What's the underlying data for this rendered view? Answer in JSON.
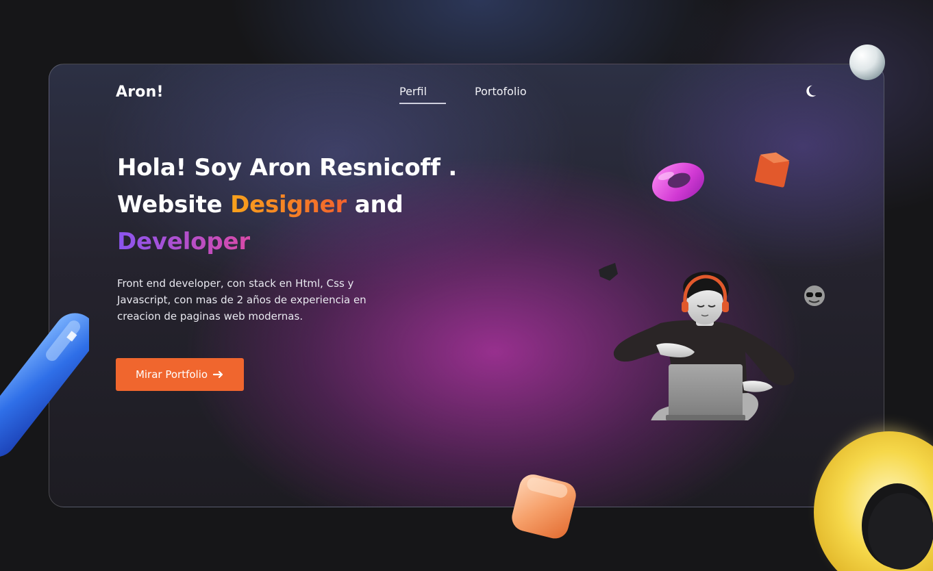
{
  "nav": {
    "logo": "Aron!",
    "links": [
      {
        "label": "Perfil",
        "active": true
      },
      {
        "label": "Portofolio",
        "active": false
      }
    ],
    "theme_icon": "moon-icon"
  },
  "hero": {
    "line1": "Hola! Soy Aron Resnicoff .",
    "line2_a": "Website ",
    "line2_highlight": "Designer",
    "line2_b": " and",
    "line3_highlight": "Developer",
    "description": "Front end developer, con stack en Html, Css y Javascript, con mas de 2 años de experiencia en creacion de paginas web modernas.",
    "cta_label": "Mirar Portfolio",
    "cta_icon": "arrow-right-icon"
  },
  "colors": {
    "accent": "#f0662e",
    "designer_gradient": [
      "#f8a21c",
      "#f2622e"
    ],
    "developer_gradient": [
      "#8a55f0",
      "#d94aa8"
    ]
  }
}
